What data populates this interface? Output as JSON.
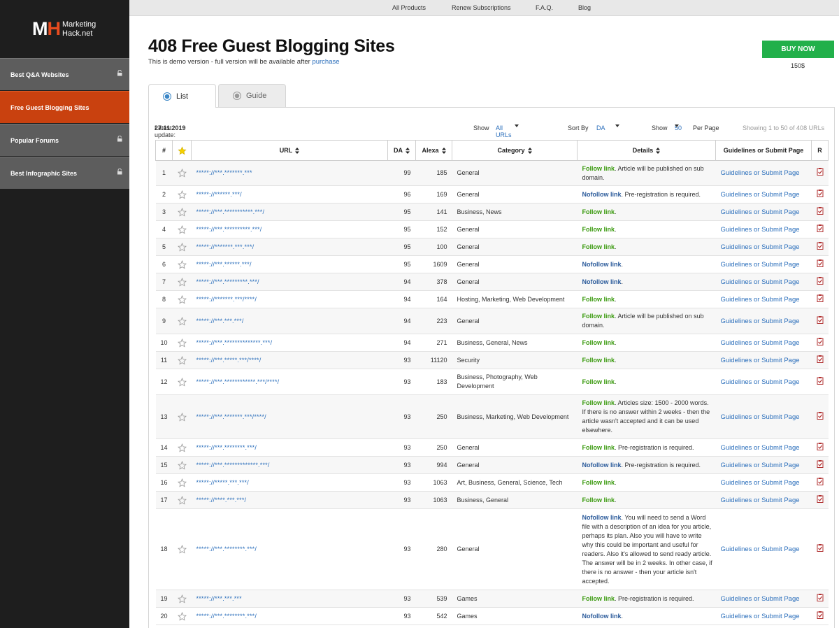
{
  "logo": {
    "mark_m": "M",
    "mark_h": "H",
    "line1": "Marketing",
    "line2": "Hack.net"
  },
  "sidebar": {
    "items": [
      {
        "label": "Best Q&A Websites"
      },
      {
        "label": "Free Guest Blogging Sites"
      },
      {
        "label": "Popular Forums"
      },
      {
        "label": "Best Infographic Sites"
      }
    ]
  },
  "topnav": {
    "items": [
      "All Products",
      "Renew Subscriptions",
      "F.A.Q.",
      "Blog"
    ]
  },
  "header": {
    "title": "408 Free Guest Blogging Sites",
    "subtitle_prefix": "This is demo version - full version will be available after ",
    "subtitle_link": "purchase",
    "buy_label": "BUY NOW",
    "price": "150$"
  },
  "tabs": [
    {
      "label": "List"
    },
    {
      "label": "Guide"
    }
  ],
  "toolbar": {
    "latest_label": "Latest update:",
    "latest_date": "27.11.2019",
    "show_label": "Show",
    "show_value": "All URLs",
    "sort_label": "Sort By",
    "sort_value": "DA",
    "perpage_label": "Show",
    "perpage_value": "50",
    "perpage_suffix": "Per Page",
    "showing": "Showing 1 to 50 of 408 URLs"
  },
  "columns": {
    "num": "#",
    "url": "URL",
    "da": "DA",
    "alexa": "Alexa",
    "category": "Category",
    "details": "Details",
    "guide": "Guidelines or Submit Page",
    "r": "R"
  },
  "rows": [
    {
      "n": "1",
      "url": "*****://***.*******.***",
      "da": "99",
      "alexa": "185",
      "cat": "General",
      "link": "Follow link",
      "detail": ". Article will be published on sub domain.",
      "guide": "Guidelines or Submit Page"
    },
    {
      "n": "2",
      "url": "*****://******.***/",
      "da": "96",
      "alexa": "169",
      "cat": "General",
      "link": "Nofollow link",
      "detail": ". Pre-registration is required.",
      "guide": "Guidelines or Submit Page"
    },
    {
      "n": "3",
      "url": "*****://***.***********.***/",
      "da": "95",
      "alexa": "141",
      "cat": "Business, News",
      "link": "Follow link",
      "detail": ".",
      "guide": "Guidelines or Submit Page"
    },
    {
      "n": "4",
      "url": "*****://***.**********.***/",
      "da": "95",
      "alexa": "152",
      "cat": "General",
      "link": "Follow link",
      "detail": ".",
      "guide": "Guidelines or Submit Page"
    },
    {
      "n": "5",
      "url": "*****://*******.***.***/",
      "da": "95",
      "alexa": "100",
      "cat": "General",
      "link": "Follow link",
      "detail": ".",
      "guide": "Guidelines or Submit Page"
    },
    {
      "n": "6",
      "url": "*****://***.******.***/",
      "da": "95",
      "alexa": "1609",
      "cat": "General",
      "link": "Nofollow link",
      "detail": ".",
      "guide": "Guidelines or Submit Page"
    },
    {
      "n": "7",
      "url": "*****://***.*********.***/",
      "da": "94",
      "alexa": "378",
      "cat": "General",
      "link": "Nofollow link",
      "detail": ".",
      "guide": "Guidelines or Submit Page"
    },
    {
      "n": "8",
      "url": "*****://*******.***/****/",
      "da": "94",
      "alexa": "164",
      "cat": "Hosting, Marketing, Web Development",
      "link": "Follow link",
      "detail": ".",
      "guide": "Guidelines or Submit Page"
    },
    {
      "n": "9",
      "url": "*****://***.***.***/",
      "da": "94",
      "alexa": "223",
      "cat": "General",
      "link": "Follow link",
      "detail": ". Article will be published on sub domain.",
      "guide": "Guidelines or Submit Page"
    },
    {
      "n": "10",
      "url": "*****://***.**************.***/",
      "da": "94",
      "alexa": "271",
      "cat": "Business, General, News",
      "link": "Follow link",
      "detail": ".",
      "guide": "Guidelines or Submit Page"
    },
    {
      "n": "11",
      "url": "*****://***.*****.***/****/",
      "da": "93",
      "alexa": "11120",
      "cat": "Security",
      "link": "Follow link",
      "detail": ".",
      "guide": "Guidelines or Submit Page"
    },
    {
      "n": "12",
      "url": "*****://***.************.***/****/",
      "da": "93",
      "alexa": "183",
      "cat": "Business, Photography, Web Development",
      "link": "Follow link",
      "detail": ".",
      "guide": "Guidelines or Submit Page"
    },
    {
      "n": "13",
      "url": "*****://***.*******.***/****/",
      "da": "93",
      "alexa": "250",
      "cat": "Business, Marketing, Web Development",
      "link": "Follow link",
      "detail": ". Articles size: 1500 - 2000 words. If there is no answer within 2 weeks - then the article wasn't accepted and it can be used elsewhere.",
      "guide": "Guidelines or Submit Page"
    },
    {
      "n": "14",
      "url": "*****://***.********.***/",
      "da": "93",
      "alexa": "250",
      "cat": "General",
      "link": "Follow link",
      "detail": ". Pre-registration is required.",
      "guide": "Guidelines or Submit Page"
    },
    {
      "n": "15",
      "url": "*****://***.*************.***/",
      "da": "93",
      "alexa": "994",
      "cat": "General",
      "link": "Nofollow link",
      "detail": ". Pre-registration is required.",
      "guide": "Guidelines or Submit Page"
    },
    {
      "n": "16",
      "url": "*****://*****.***.***/",
      "da": "93",
      "alexa": "1063",
      "cat": "Art, Business, General, Science, Tech",
      "link": "Follow link",
      "detail": ".",
      "guide": "Guidelines or Submit Page"
    },
    {
      "n": "17",
      "url": "*****://****.***.***/",
      "da": "93",
      "alexa": "1063",
      "cat": "Business, General",
      "link": "Follow link",
      "detail": ".",
      "guide": "Guidelines or Submit Page"
    },
    {
      "n": "18",
      "url": "*****://***.********.***/",
      "da": "93",
      "alexa": "280",
      "cat": "General",
      "link": "Nofollow link",
      "detail": ". You will need to send a Word file with a description of an idea for you article, perhaps its plan. Also you will have to write why this could be important and useful for readers.  Also it's allowed to send ready article. The answer will be in 2 weeks. In other case, if there is no answer - then your article isn't accepted.",
      "guide": "Guidelines or Submit Page"
    },
    {
      "n": "19",
      "url": "*****://***.***.***",
      "da": "93",
      "alexa": "539",
      "cat": "Games",
      "link": "Follow link",
      "detail": ". Pre-registration is required.",
      "guide": "Guidelines or Submit Page"
    },
    {
      "n": "20",
      "url": "*****://***.********.***/",
      "da": "93",
      "alexa": "542",
      "cat": "Games",
      "link": "Nofollow link",
      "detail": ".",
      "guide": "Guidelines or Submit Page"
    }
  ],
  "colors": {
    "accent": "#c9410f",
    "buy": "#22b04a",
    "link": "#2a6ebb",
    "follow": "#3a9a0e",
    "nofollow": "#2a5a9a"
  },
  "icons": {
    "star": "star-outline-icon",
    "header_star": "star-filled-icon",
    "report": "report-icon",
    "lock": "lock-icon",
    "sort": "sort-arrows-icon"
  }
}
